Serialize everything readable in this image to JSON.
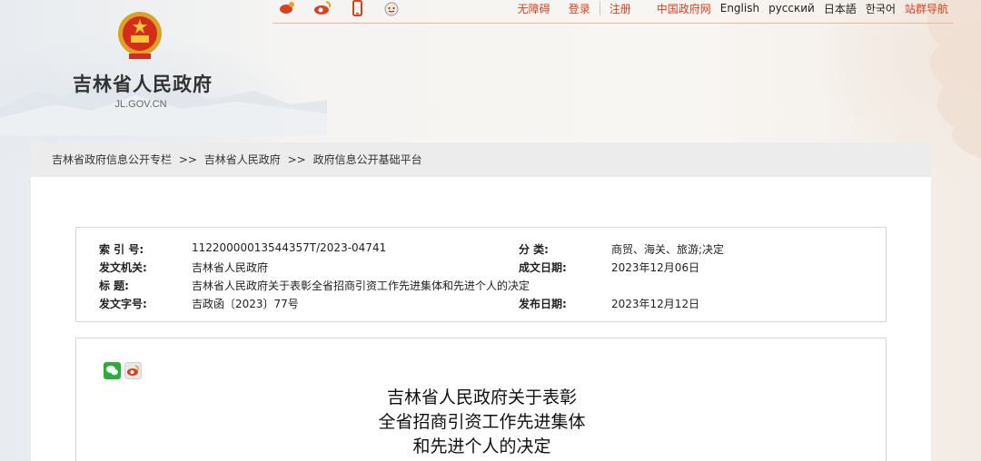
{
  "header": {
    "site_name": "吉林省人民政府",
    "site_domain": "JL.GOV.CN"
  },
  "topnav": {
    "social_icons": [
      "weibo-icon",
      "weibo-logo-icon",
      "mobile-icon",
      "avatar-icon"
    ],
    "accessibility": "无障碍",
    "login": "登录",
    "register": "注册",
    "china_gov": "中国政府网",
    "english": "English",
    "russian": "русский",
    "japanese": "日本語",
    "korean": "한국어",
    "site_nav": "站群导航"
  },
  "breadcrumb": {
    "items": [
      "吉林省政府信息公开专栏",
      "吉林省人民政府",
      "政府信息公开基础平台"
    ],
    "separator": ">>"
  },
  "info": {
    "index_label": "索 引 号:",
    "index_value": "11220000013544357T/2023-04741",
    "category_label": "分 类:",
    "category_value": "商贸、海关、旅游;决定",
    "issuer_label": "发文机关:",
    "issuer_value": "吉林省人民政府",
    "created_label": "成文日期:",
    "created_value": "2023年12月06日",
    "title_label": "标 题:",
    "title_value": "吉林省人民政府关于表彰全省招商引资工作先进集体和先进个人的决定",
    "docno_label": "发文字号:",
    "docno_value": "吉政函〔2023〕77号",
    "published_label": "发布日期:",
    "published_value": "2023年12月12日"
  },
  "document": {
    "title_line1": "吉林省人民政府关于表彰",
    "title_line2": "全省招商引资工作先进集体",
    "title_line3": "和先进个人的决定",
    "share_icons": [
      "wechat-icon",
      "weibo-icon"
    ]
  },
  "colors": {
    "accent": "#d9421f",
    "breadcrumb_bg": "#ececec",
    "border": "#d6d6d6"
  }
}
